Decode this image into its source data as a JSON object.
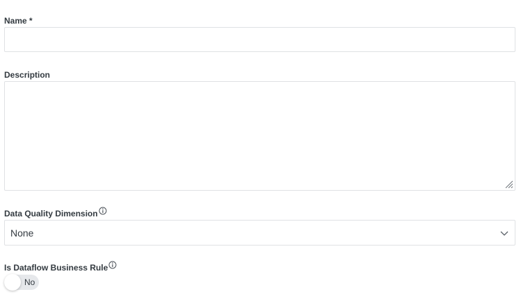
{
  "fields": {
    "name": {
      "label": "Name *",
      "value": ""
    },
    "description": {
      "label": "Description",
      "value": ""
    },
    "dq_dimension": {
      "label": "Data Quality Dimension",
      "selected": "None"
    },
    "dataflow_rule": {
      "label": "Is Dataflow Business Rule",
      "toggle_text": "No",
      "on": false
    }
  },
  "icons": {
    "info": "info-circle-icon",
    "chevron": "chevron-down-icon",
    "resize": "resize-handle-icon"
  },
  "colors": {
    "border": "#dfe1e4",
    "text": "#333a40",
    "toggle_track": "#e6e8eb"
  }
}
